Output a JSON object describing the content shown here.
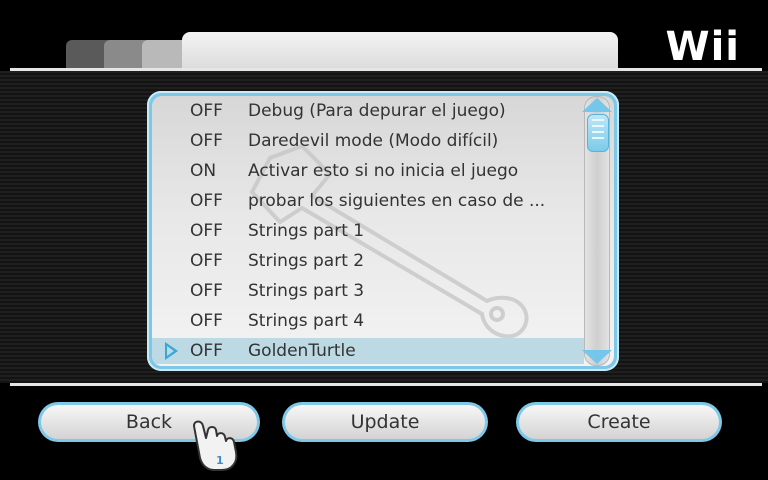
{
  "brand": {
    "logo_text": "Wii"
  },
  "list": {
    "rows": [
      {
        "status": "OFF",
        "label": "Debug (Para depurar el juego)",
        "selected": false
      },
      {
        "status": "OFF",
        "label": "Daredevil mode (Modo difícil)",
        "selected": false
      },
      {
        "status": "ON",
        "label": "Activar esto si no inicia el juego",
        "selected": false
      },
      {
        "status": "OFF",
        "label": "probar los siguientes en caso de ...",
        "selected": false
      },
      {
        "status": "OFF",
        "label": "Strings part 1",
        "selected": false
      },
      {
        "status": "OFF",
        "label": "Strings part 2",
        "selected": false
      },
      {
        "status": "OFF",
        "label": "Strings part 3",
        "selected": false
      },
      {
        "status": "OFF",
        "label": "Strings part 4",
        "selected": false
      },
      {
        "status": "OFF",
        "label": "GoldenTurtle",
        "selected": true
      }
    ]
  },
  "buttons": {
    "back": "Back",
    "update": "Update",
    "create": "Create"
  },
  "pointer": {
    "player_number": "1"
  },
  "colors": {
    "accent": "#7ec7e6",
    "selection": "#bcd9e4"
  }
}
